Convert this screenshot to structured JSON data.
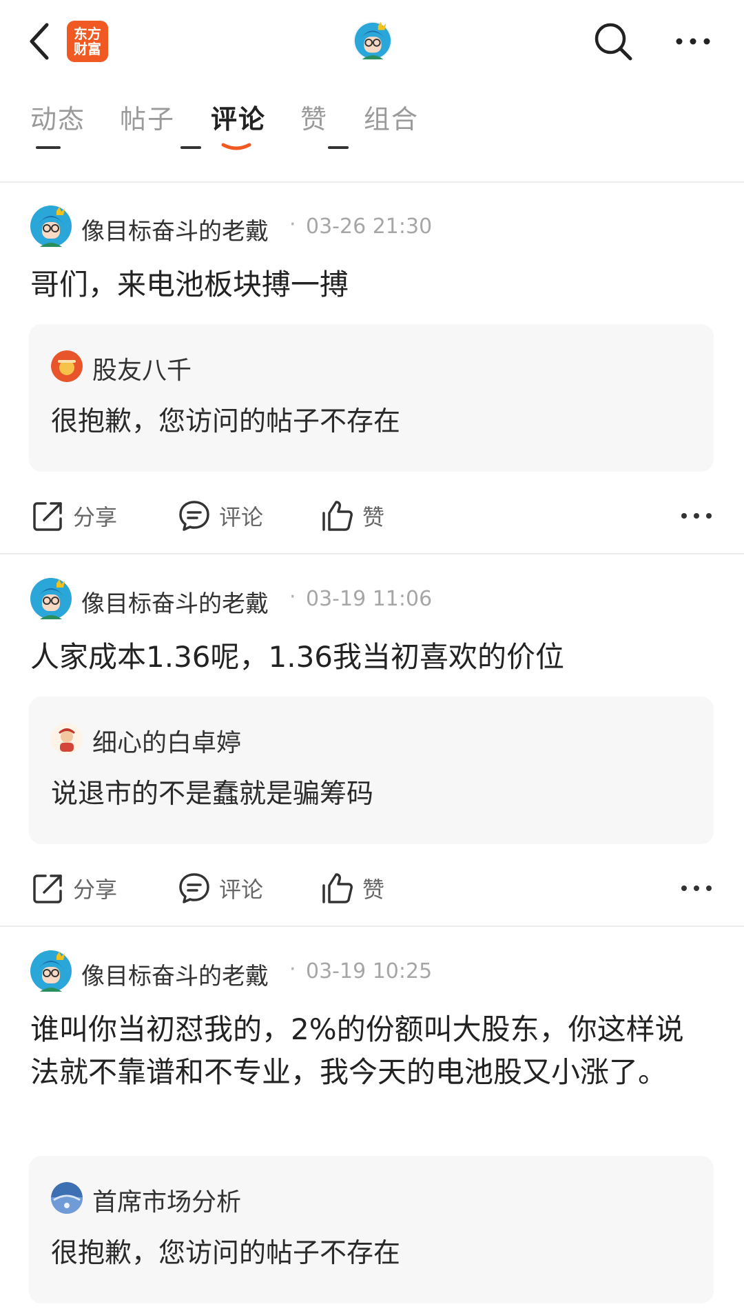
{
  "header": {
    "back_icon": "chevron-left-icon",
    "app_logo": {
      "line1": "东方",
      "line2": "财富",
      "color": "#f05a22"
    },
    "search_icon": "search-icon",
    "more_icon": "more-horizontal-icon"
  },
  "tabs": [
    {
      "label": "动态",
      "active": false
    },
    {
      "label": "帖子",
      "active": false
    },
    {
      "label": "评论",
      "active": true
    },
    {
      "label": "赞",
      "active": false
    },
    {
      "label": "组合",
      "active": false
    }
  ],
  "accent_color": "#f05a22",
  "action_labels": {
    "share": "分享",
    "comment": "评论",
    "like": "赞"
  },
  "posts": [
    {
      "author": "像目标奋斗的老戴",
      "dot": "·",
      "time": "03-26 21:30",
      "text": "哥们，来电池板块搏一搏",
      "quote": {
        "name": "股友八千",
        "text": "很抱歉，您访问的帖子不存在"
      }
    },
    {
      "author": "像目标奋斗的老戴",
      "dot": "·",
      "time": "03-19 11:06",
      "text": "人家成本1.36呢，1.36我当初喜欢的价位",
      "quote": {
        "name": "细心的白卓婷",
        "text": "说退市的不是蠢就是骗筹码"
      }
    },
    {
      "author": "像目标奋斗的老戴",
      "dot": "·",
      "time": "03-19 10:25",
      "text": "谁叫你当初怼我的，2%的份额叫大股东，你这样说法就不靠谱和不专业，我今天的电池股又小涨了。",
      "quote": {
        "name": "首席市场分析",
        "text": "很抱歉，您访问的帖子不存在"
      }
    }
  ]
}
